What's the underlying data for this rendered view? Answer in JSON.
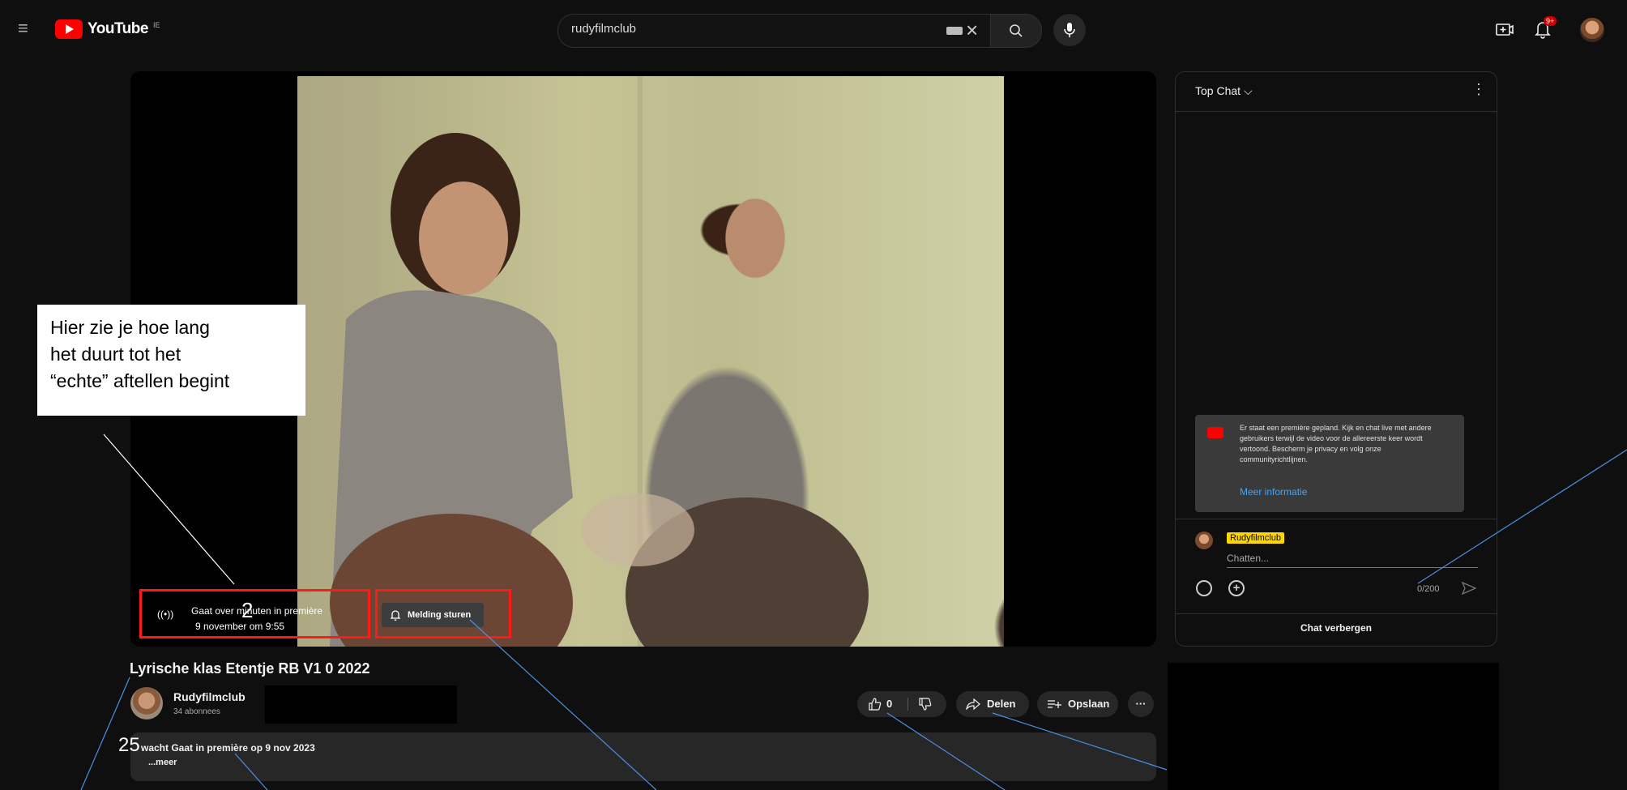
{
  "header": {
    "logo_text": "YouTube",
    "logo_country": "IE",
    "search_value": "rudyfilmclub",
    "notif_badge": "9+"
  },
  "player": {
    "premiere_line1": "Gaat over   minuten in première",
    "premiere_number": "2",
    "premiere_date": "9 november om 9:55",
    "notify_label": "Melding sturen"
  },
  "callout": {
    "lines": [
      "Hier zie je hoe lang",
      "het duurt tot het",
      "“echte” aftellen begint"
    ]
  },
  "video": {
    "title": "Lyrische klas Etentje RB V1 0 2022",
    "channel_name": "Rudyfilmclub",
    "subscribers": "34 abonnees",
    "like_count": "0",
    "share_label": "Delen",
    "save_label": "Opslaan",
    "more_label": "···",
    "desc_number": "25",
    "desc_line": "wacht  Gaat in première op 9 nov 2023",
    "desc_more": "...meer"
  },
  "chat": {
    "title": "Top Chat",
    "info_text": "Er staat een première gepland. Kijk en chat live met andere gebruikers terwijl de video voor de allereerste keer wordt vertoond. Bescherm je privacy en volg onze communityrichtlijnen.",
    "info_link": "Meer informatie",
    "user_name": "Rudyfilmclub",
    "input_placeholder": "Chatten...",
    "char_count": "0/200",
    "hide_label": "Chat verbergen"
  },
  "colors": {
    "accent_red": "#ff0000",
    "callout_border": "#ff1a1a",
    "link_blue": "#3ea6ff",
    "username_highlight": "#ffd600",
    "annotation_line": "#4a90e2"
  }
}
